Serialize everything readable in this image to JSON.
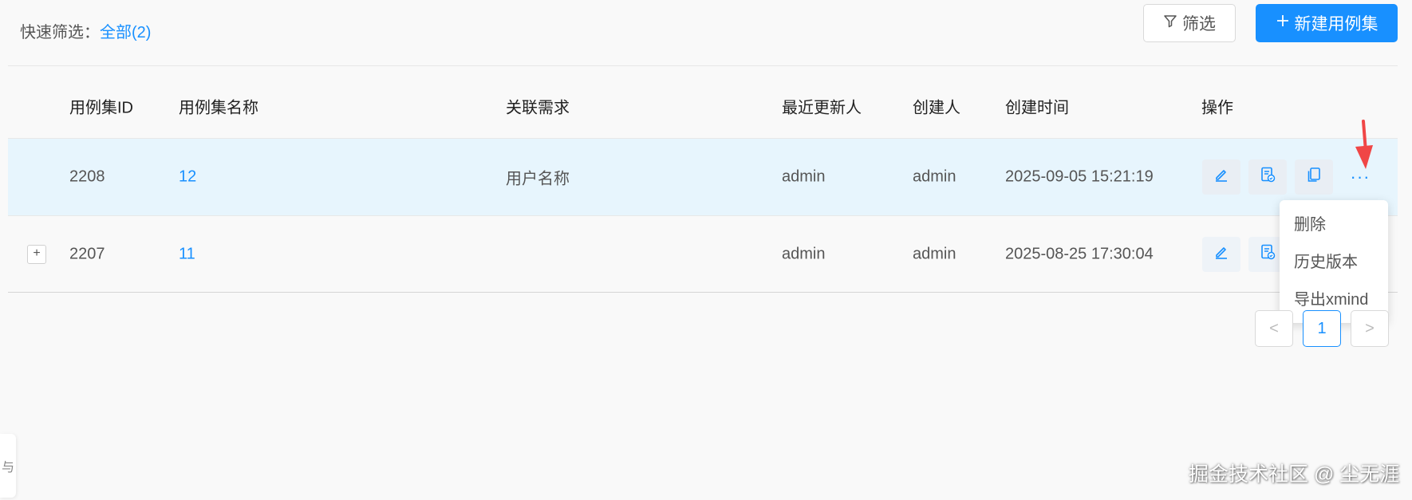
{
  "toolbar": {
    "quick_filter_label": "快速筛选：",
    "quick_filter_all": "全部(2)",
    "filter_button": "筛选",
    "new_button": "新建用例集"
  },
  "table": {
    "headers": {
      "id": "用例集ID",
      "name": "用例集名称",
      "requirement": "关联需求",
      "updater": "最近更新人",
      "creator": "创建人",
      "created_at": "创建时间",
      "ops": "操作"
    },
    "rows": [
      {
        "id": "2208",
        "name": "12",
        "requirement": "用户名称",
        "updater": "admin",
        "creator": "admin",
        "created_at": "2025-09-05 15:21:19"
      },
      {
        "id": "2207",
        "name": "11",
        "requirement": "",
        "updater": "admin",
        "creator": "admin",
        "created_at": "2025-08-25 17:30:04"
      }
    ],
    "expand_symbol": "+",
    "more_symbol": "···"
  },
  "dropdown": {
    "items": [
      "删除",
      "历史版本",
      "导出xmind"
    ]
  },
  "pagination": {
    "prev": "<",
    "current": "1",
    "next": ">"
  },
  "side_tab": {
    "label": "与"
  },
  "watermark": "掘金技术社区 @ 尘无涯",
  "colors": {
    "accent": "#1890ff",
    "row_hover": "#e7f5fd",
    "arrow": "#f04646"
  }
}
